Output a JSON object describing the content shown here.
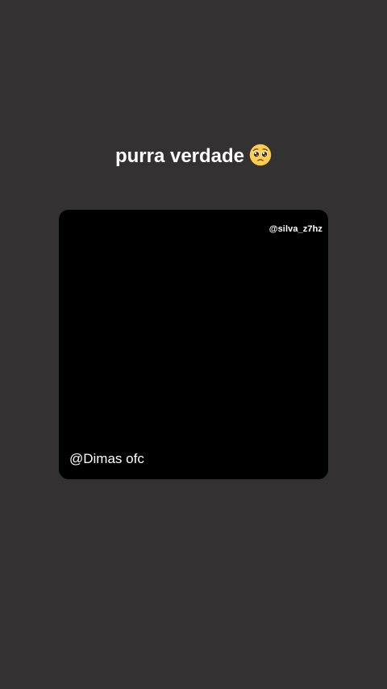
{
  "story": {
    "caption_text": "purra verdade",
    "caption_emoji": "pleading-face-emoji",
    "watermark": "@silva_z7hz",
    "author": "@Dimas ofc"
  },
  "colors": {
    "background": "#333132",
    "card": "#000000",
    "text": "#ffffff",
    "emoji_face": "#FFCC4D"
  }
}
